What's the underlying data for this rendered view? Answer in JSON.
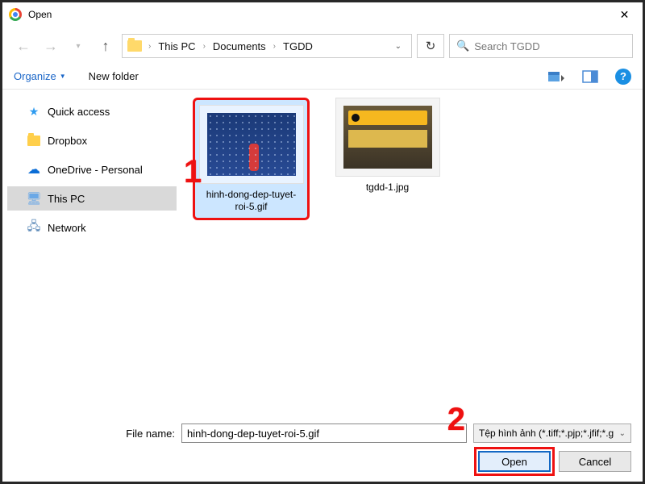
{
  "window": {
    "title": "Open"
  },
  "breadcrumb": {
    "seg1": "This PC",
    "seg2": "Documents",
    "seg3": "TGDD"
  },
  "search": {
    "placeholder": "Search TGDD"
  },
  "toolbar": {
    "organize": "Organize",
    "new_folder": "New folder"
  },
  "sidebar": {
    "items": [
      {
        "label": "Quick access"
      },
      {
        "label": "Dropbox"
      },
      {
        "label": "OneDrive - Personal"
      },
      {
        "label": "This PC"
      },
      {
        "label": "Network"
      }
    ]
  },
  "files": [
    {
      "name": "hinh-dong-dep-tuyet-roi-5.gif",
      "selected": true
    },
    {
      "name": "tgdd-1.jpg",
      "selected": false
    }
  ],
  "footer": {
    "filename_label": "File name:",
    "filename_value": "hinh-dong-dep-tuyet-roi-5.gif",
    "filetype": "Tệp hình ảnh (*.tiff;*.pjp;*.jfif;*.g",
    "open": "Open",
    "cancel": "Cancel"
  },
  "callouts": {
    "one": "1",
    "two": "2"
  }
}
